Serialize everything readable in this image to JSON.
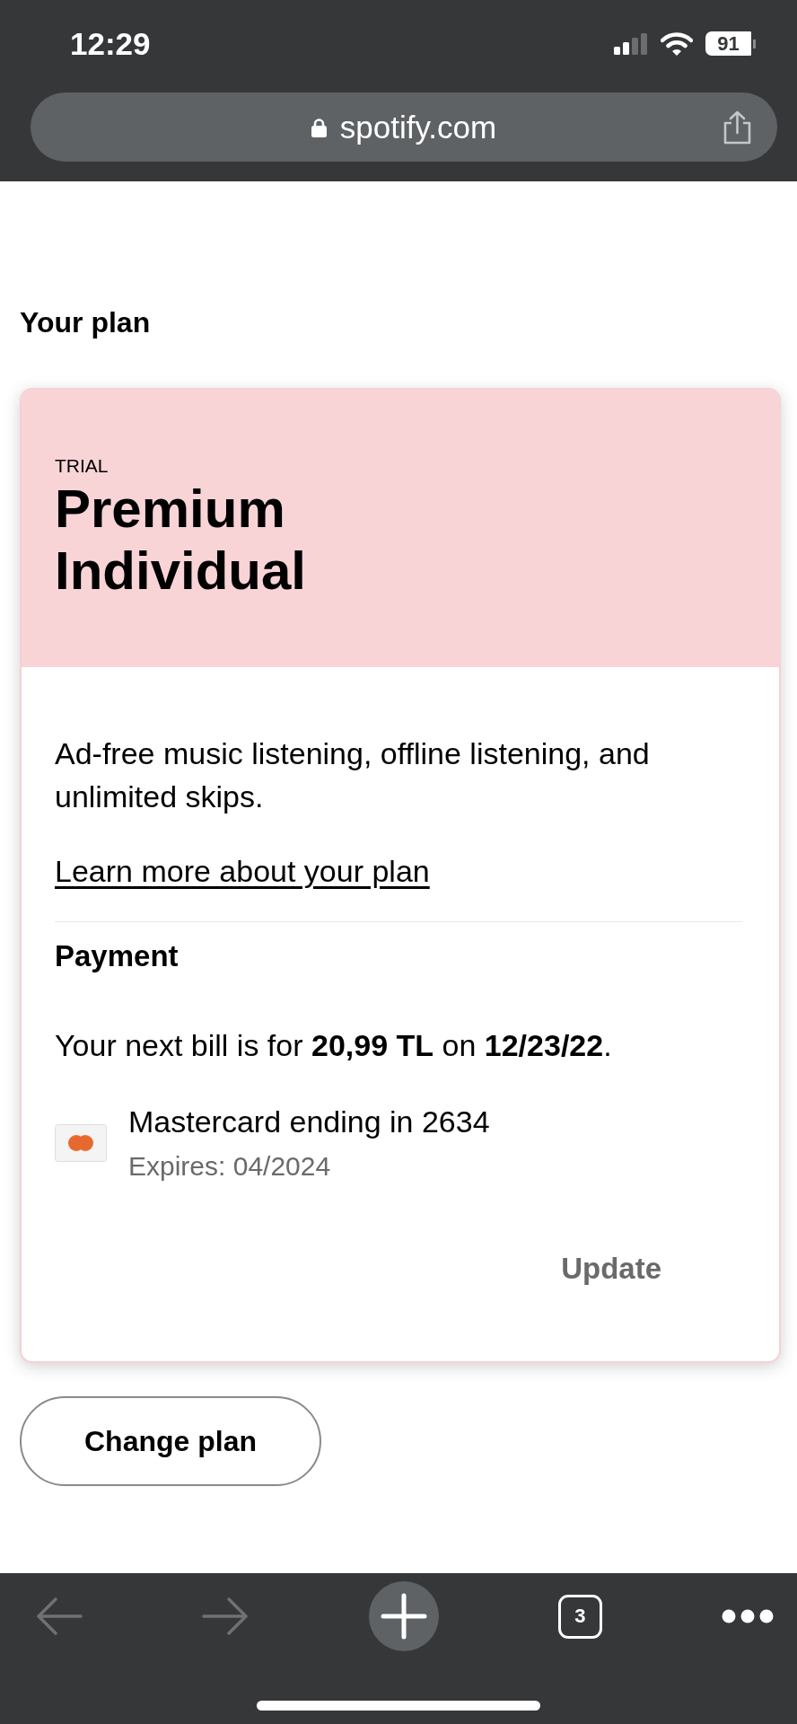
{
  "status_bar": {
    "time": "12:29",
    "battery": "91"
  },
  "address_bar": {
    "url": "spotify.com"
  },
  "heading": "Your plan",
  "plan_card": {
    "tag": "TRIAL",
    "title": "Premium Individual",
    "description": "Ad-free music listening, offline listening, and unlimited skips.",
    "link": "Learn more about your plan",
    "payment": {
      "heading": "Payment",
      "bill": "Your next bill is for **20,99 TL** on **12/23/22**.",
      "card_name": "Mastercard ending in 2634",
      "expiry": "Expires: 04/2024",
      "button": "Update"
    }
  },
  "change_plan_button": "Change plan",
  "toolbar": {
    "items": [
      {
        "kind": "back",
        "disabled": true
      },
      {
        "kind": "forward",
        "disabled": true
      },
      {
        "kind": "new_tab",
        "disabled": false
      },
      {
        "kind": "tabs",
        "label": "3",
        "disabled": false
      },
      {
        "kind": "more",
        "disabled": false
      }
    ]
  }
}
